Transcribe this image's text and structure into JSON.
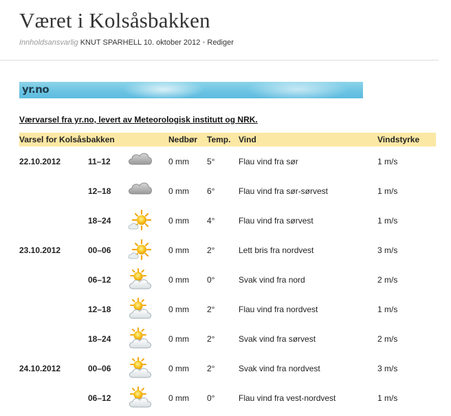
{
  "post": {
    "title": "Været i Kolsåsbakken",
    "meta_label": "Innholdsansvarlig",
    "author": "KNUT SPARHELL",
    "date": "10. oktober 2012",
    "separator": "•",
    "edit_label": "Rediger"
  },
  "banner": {
    "logo_text": "yr.no",
    "colors": {
      "sky": "#6cc4e3",
      "logo": "#1f3d4c"
    }
  },
  "source_link": "Værvarsel fra yr.no, levert av Meteorologisk institutt og NRK.",
  "table": {
    "header_bg": "#fbe8a4",
    "headers": {
      "place": "Varsel for Kolsåsbakken",
      "rain": "Nedbør",
      "temp": "Temp.",
      "wind": "Vind",
      "strength": "Vindstyrke"
    },
    "rows": [
      {
        "date": "22.10.2012",
        "time": "11–12",
        "icon": "cloudy-icon",
        "rain": "0 mm",
        "temp": "5°",
        "wind": "Flau vind fra sør",
        "strength": "1 m/s"
      },
      {
        "date": "",
        "time": "12–18",
        "icon": "cloudy-icon",
        "rain": "0 mm",
        "temp": "6°",
        "wind": "Flau vind fra sør-sørvest",
        "strength": "1 m/s"
      },
      {
        "date": "",
        "time": "18–24",
        "icon": "sun-cloud-icon",
        "rain": "0 mm",
        "temp": "4°",
        "wind": "Flau vind fra sørvest",
        "strength": "1 m/s"
      },
      {
        "date": "23.10.2012",
        "time": "00–06",
        "icon": "sun-cloud-icon",
        "rain": "0 mm",
        "temp": "2°",
        "wind": "Lett bris fra nordvest",
        "strength": "3 m/s"
      },
      {
        "date": "",
        "time": "06–12",
        "icon": "partly-cloudy-icon",
        "rain": "0 mm",
        "temp": "0°",
        "wind": "Svak vind fra nord",
        "strength": "2 m/s"
      },
      {
        "date": "",
        "time": "12–18",
        "icon": "partly-cloudy-icon",
        "rain": "0 mm",
        "temp": "2°",
        "wind": "Flau vind fra nordvest",
        "strength": "1 m/s"
      },
      {
        "date": "",
        "time": "18–24",
        "icon": "partly-cloudy-icon",
        "rain": "0 mm",
        "temp": "2°",
        "wind": "Svak vind fra sørvest",
        "strength": "2 m/s"
      },
      {
        "date": "24.10.2012",
        "time": "00–06",
        "icon": "partly-cloudy-icon",
        "rain": "0 mm",
        "temp": "2°",
        "wind": "Svak vind fra nordvest",
        "strength": "3 m/s"
      },
      {
        "date": "",
        "time": "06–12",
        "icon": "partly-cloudy-icon",
        "rain": "0 mm",
        "temp": "0°",
        "wind": "Flau vind fra vest-nordvest",
        "strength": "1 m/s"
      }
    ]
  }
}
